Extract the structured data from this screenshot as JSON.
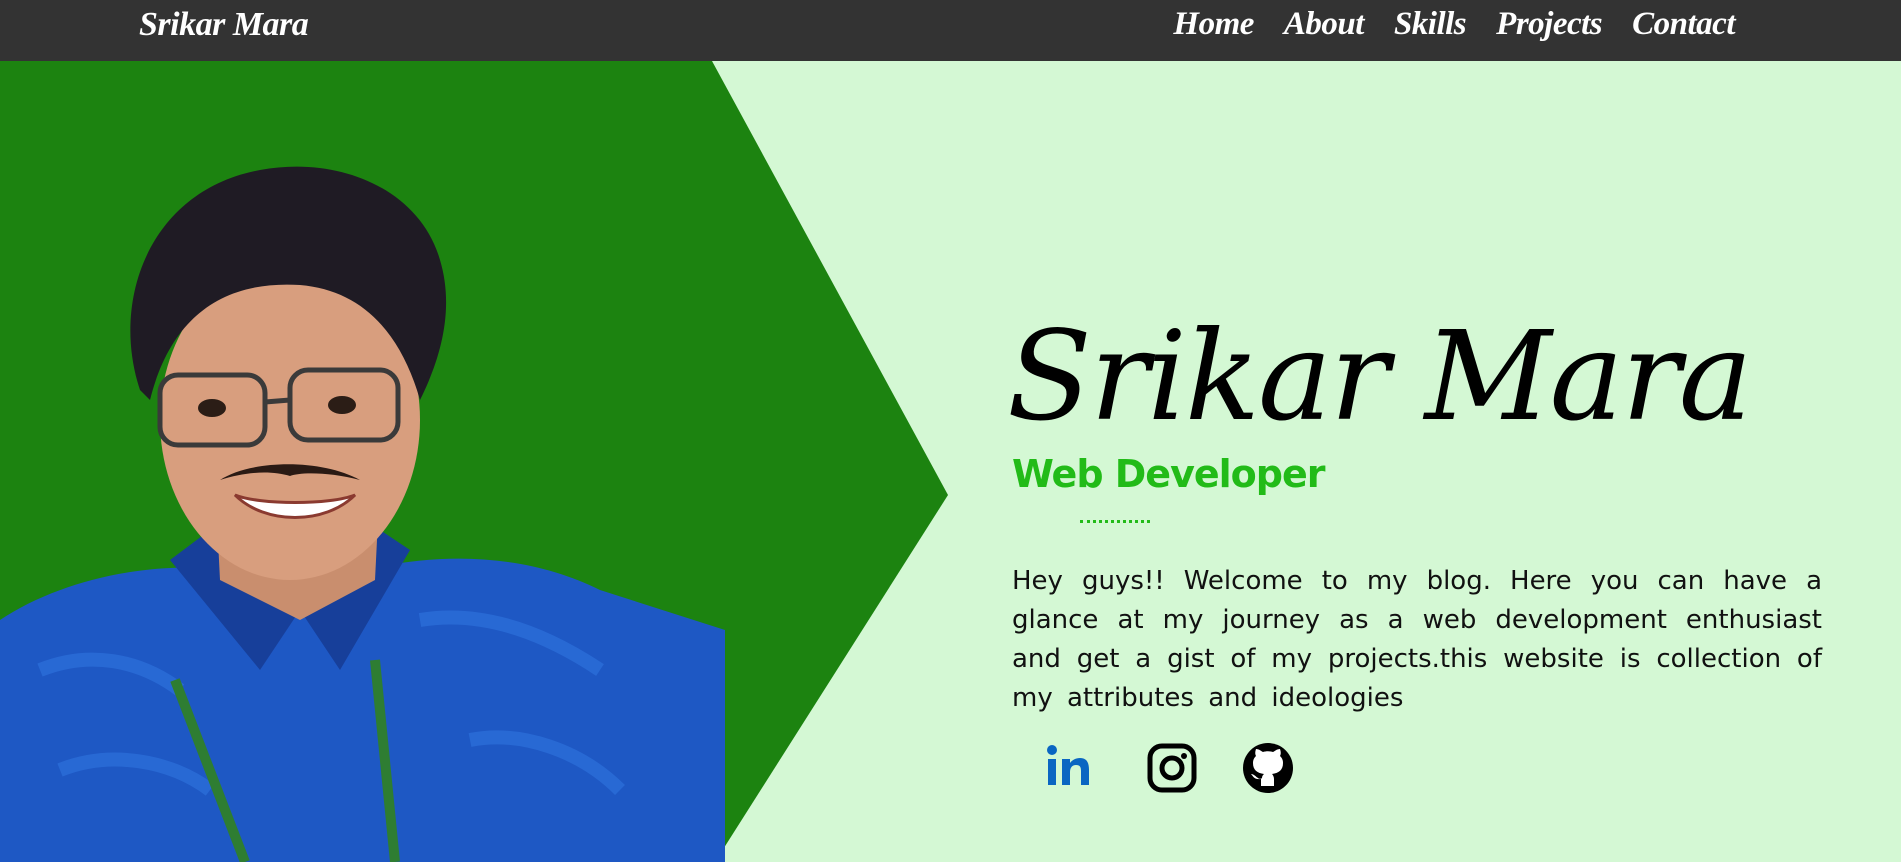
{
  "nav": {
    "brand": "Srikar Mara",
    "links": [
      "Home",
      "About",
      "Skills",
      "Projects",
      "Contact"
    ]
  },
  "hero": {
    "name": "Srikar Mara",
    "role": "Web Developer",
    "bio": "Hey guys!! Welcome to my blog. Here you can have a glance at my journey as a web development enthusiast and get a gist of my projects.this website is collection of my attributes and ideologies"
  },
  "socials": [
    "linkedin-icon",
    "instagram-icon",
    "github-icon"
  ],
  "colors": {
    "navbar": "#333333",
    "background": "#d4f8d4",
    "chevron": "#1c8310",
    "role": "#22bb18",
    "linkedin": "#0a66c2"
  }
}
